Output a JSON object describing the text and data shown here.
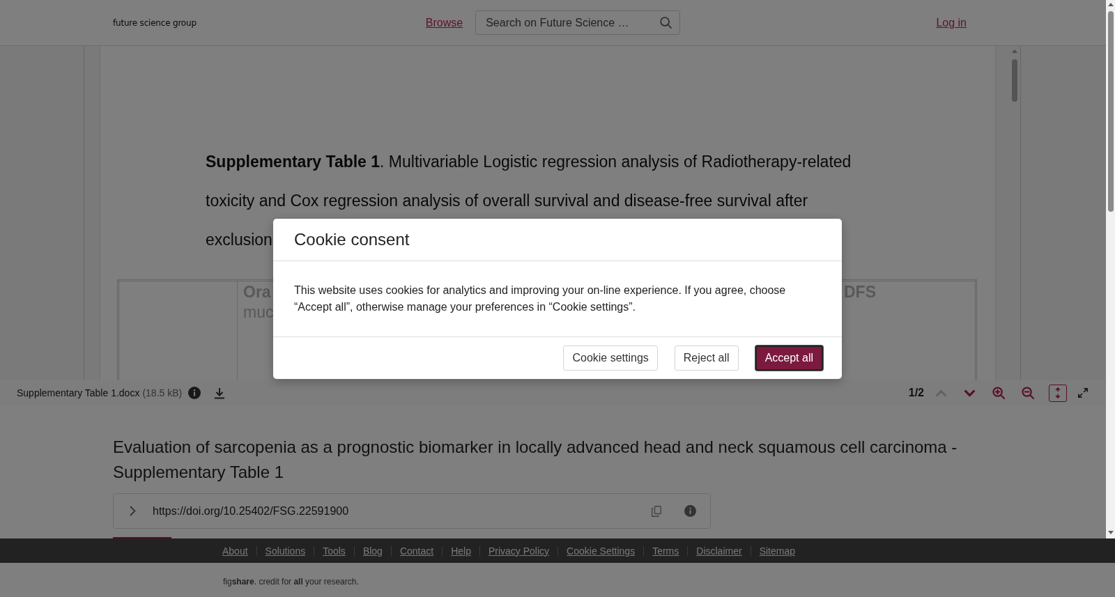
{
  "header": {
    "logo": "future science group",
    "nav_link": "Browse",
    "search": {
      "placeholder": "Search on Future Science …"
    },
    "login": "Log in"
  },
  "viewer": {
    "caption_lines": [
      "**Supplementary Table 1**. Multivariable Logistic regression analysis of Radiotherapy-related",
      "toxicity and Cox regression analysis of overall survival and disease-free survival after",
      "exclusion"
    ],
    "table": {
      "column_2_heading": [
        "Ora",
        "muc"
      ],
      "column_3_heading": [
        "DFS"
      ]
    },
    "toolbar": {
      "file_name": "Supplementary Table 1.docx",
      "file_size": "(18.5 kB)",
      "page_indicator": "1/2",
      "previous_disabled": true,
      "next_disabled": false,
      "fit_height_selected": true
    }
  },
  "item": {
    "title": "Evaluation of sarcopenia as a prognostic biomarker in locally advanced head and neck squamous cell carcinoma - Supplementary Table 1",
    "doi": "https://doi.org/10.25402/FSG.22591900"
  },
  "footer": {
    "links": [
      "About",
      "Solutions",
      "Tools",
      "Blog",
      "Contact",
      "Help",
      "Privacy Policy",
      "Cookie Settings",
      "Terms",
      "Disclaimer",
      "Sitemap"
    ],
    "tagline": "fig**share**. credit for **all** your research."
  },
  "cookie_dialog": {
    "title": "Cookie consent",
    "text": "This website uses cookies for analytics and improving your on-line experience. If you agree, choose “Accept all”, otherwise manage your preferences in “Cookie settings”.",
    "buttons": [
      {
        "label": "Cookie settings",
        "primary": false
      },
      {
        "label": "Reject all",
        "primary": false
      },
      {
        "label": "Accept all",
        "primary": true
      }
    ]
  }
}
